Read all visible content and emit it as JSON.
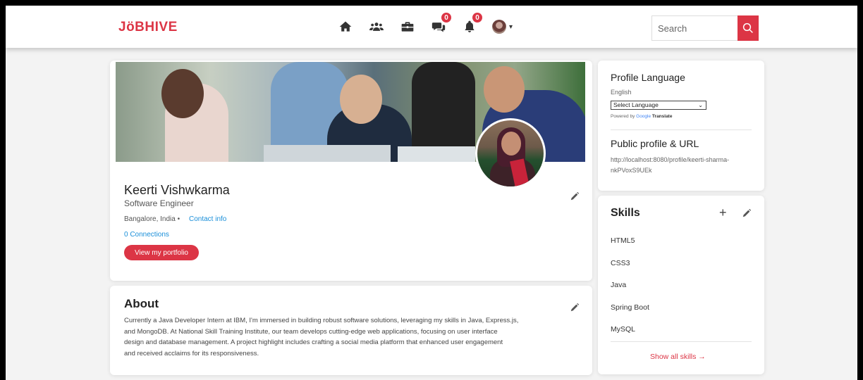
{
  "navbar": {
    "logo": "JöBHIVE",
    "icons": [
      "home-icon",
      "network-icon",
      "jobs-icon",
      "messages-icon",
      "notifications-icon"
    ],
    "messages_badge": "0",
    "notifications_badge": "0",
    "search_placeholder": "Search",
    "accent_color": "#dc3545"
  },
  "profile": {
    "name": "Keerti Vishwkarma",
    "title": "Software Engineer",
    "location": "Bangalore, India •",
    "contact_link": "Contact info",
    "connections": "0 Connections",
    "portfolio_button": "View my portfolio"
  },
  "about": {
    "heading": "About",
    "text_lines": [
      "Currently a Java Developer Intern at IBM, I'm immersed in building robust software solutions, leveraging my skills in Java, Express.js,",
      "and MongoDB. At National Skill Training Institute, our team develops cutting-edge web applications, focusing on user interface",
      "design and database management. A project highlight includes crafting a social media platform that enhanced user engagement",
      "and received acclaims for its responsiveness."
    ]
  },
  "language": {
    "heading": "Profile Language",
    "current": "English",
    "select_value": "Select Language",
    "powered_by": "Powered by",
    "google": "Google",
    "translate": "Translate"
  },
  "public_profile": {
    "heading": "Public profile & URL",
    "url": "http://localhost:8080/profile/keerti-sharma-nkPVoxS9UEk"
  },
  "skills": {
    "heading": "Skills",
    "items": [
      "HTML5",
      "CSS3",
      "Java",
      "Spring Boot",
      "MySQL"
    ],
    "show_all": "Show all skills →"
  }
}
